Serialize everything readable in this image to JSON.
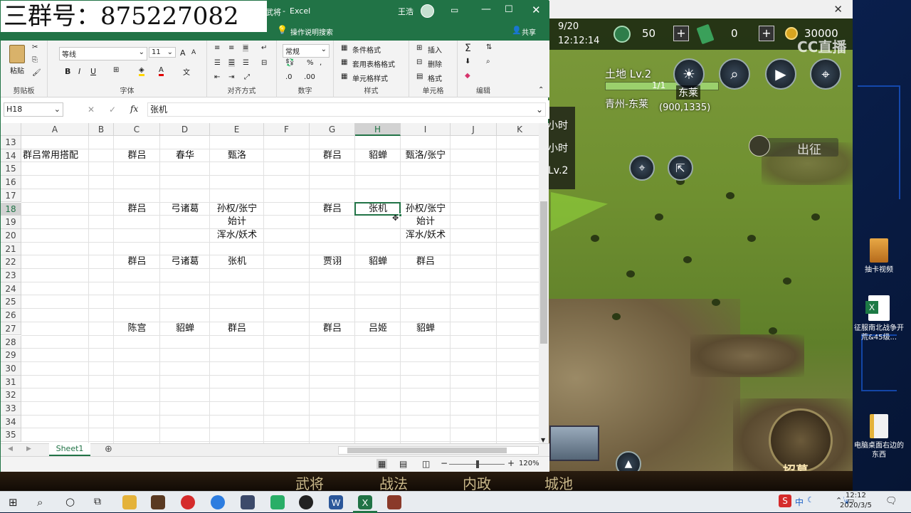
{
  "watermark": "三群号：875227082",
  "excel": {
    "title_fragment": "武将",
    "app_name": "Excel",
    "user": "王浩",
    "tell_me": "操作说明搜索",
    "share": "共享",
    "ribbon": {
      "paste": "粘贴",
      "clipboard": "剪贴板",
      "font_name": "等线",
      "font_size": "11",
      "font_grow": "A",
      "font_shrink": "A",
      "bold": "B",
      "italic": "I",
      "underline": "U",
      "font_group": "字体",
      "align_group": "对齐方式",
      "number_format": "常规",
      "number_group": "数字",
      "cond_format": "条件格式",
      "table_format": "套用表格格式",
      "cell_style": "单元格样式",
      "styles_group": "样式",
      "insert": "插入",
      "delete": "删除",
      "format": "格式",
      "cells_group": "单元格",
      "edit_group": "编辑"
    },
    "name_box": "H18",
    "formula_value": "张机",
    "columns": [
      "A",
      "B",
      "C",
      "D",
      "E",
      "F",
      "G",
      "H",
      "I",
      "J",
      "K"
    ],
    "rows": [
      "13",
      "14",
      "15",
      "16",
      "17",
      "18",
      "19",
      "20",
      "21",
      "22",
      "23",
      "24",
      "25",
      "26",
      "27",
      "28",
      "29",
      "30",
      "31",
      "32",
      "33",
      "34",
      "35"
    ],
    "cells": {
      "a14": "群吕常用搭配",
      "c14": "群吕",
      "d14": "春华",
      "e14": "甄洛",
      "g14": "群吕",
      "h14": "貂蝉",
      "i14": "甄洛/张宁",
      "c18": "群吕",
      "d18": "弓诸葛",
      "e18": "孙权/张宁",
      "g18": "群吕",
      "h18": "张机",
      "i18": "孙权/张宁",
      "e19": "始计",
      "i19": "始计",
      "e20": "浑水/妖术",
      "i20": "浑水/妖术",
      "c22": "群吕",
      "d22": "弓诸葛",
      "e22": "张机",
      "g22": "贾诩",
      "h22": "貂蝉",
      "i22": "群吕",
      "c27": "陈宫",
      "d27": "貂蝉",
      "e27": "群吕",
      "g27": "群吕",
      "h27": "吕姬",
      "i27": "貂蝉"
    },
    "sheet_tab": "Sheet1",
    "zoom": "120%"
  },
  "game": {
    "date": "9/20",
    "time": "12:12:14",
    "jade": "50",
    "tokens": "0",
    "gold": "30000",
    "logo": "CC直播",
    "land_level": "土地 Lv.2",
    "land_progress_text": "1/1",
    "land_progress": 1.0,
    "location": "青州-东莱",
    "coords": "(900,1335)",
    "city_label": "东莱",
    "side_labels": [
      "小时",
      "小时",
      "Lv.2"
    ],
    "march": "出征",
    "bottom_tabs": [
      "武将",
      "战法",
      "内政",
      "城池"
    ],
    "recruit": "招募"
  },
  "desktop": {
    "icons": [
      {
        "label": "抽卡视频"
      },
      {
        "label": "征服南北战争开荒&45级..."
      },
      {
        "label": "电脑桌面右边的东西"
      }
    ]
  },
  "taskbar": {
    "ime": "中",
    "clock_time": "12:12",
    "clock_date": "2020/3/5"
  }
}
